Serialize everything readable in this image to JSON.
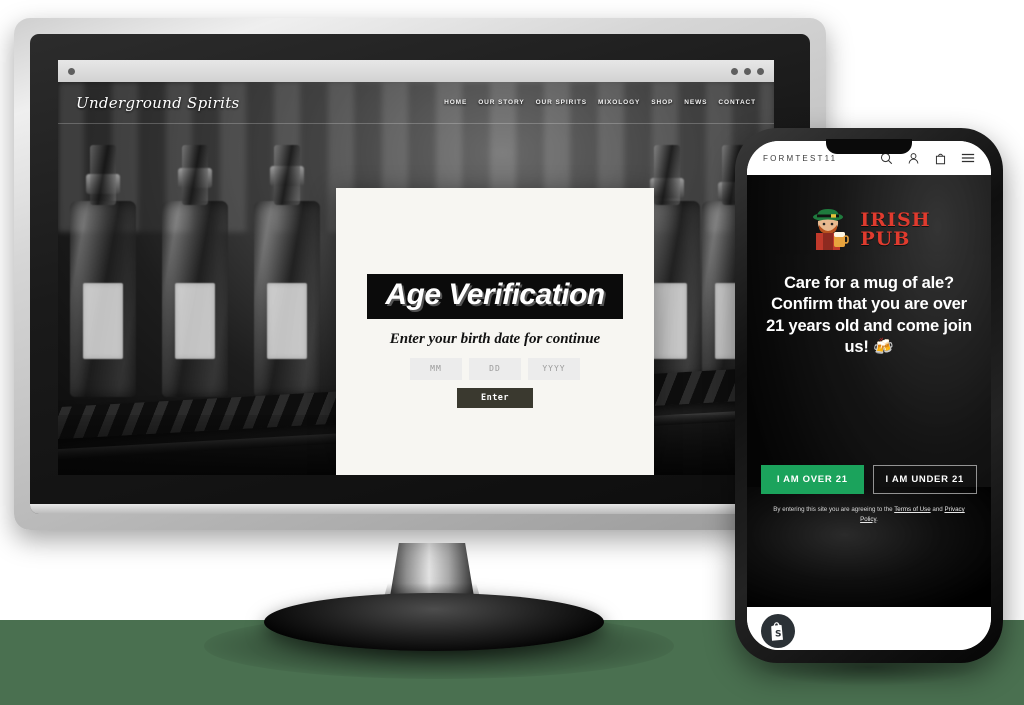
{
  "background": {
    "color": "#4a7050"
  },
  "desktop": {
    "browser": {
      "dots": 3
    },
    "site": {
      "logo": "Underground Spirits",
      "nav": [
        "HOME",
        "OUR STORY",
        "OUR SPIRITS",
        "MIXOLOGY",
        "SHOP",
        "NEWS",
        "CONTACT"
      ],
      "scroll_indicator_icon": "chevron-down-icon"
    },
    "age_modal": {
      "title": "Age Verification",
      "subtitle": "Enter your birth date for continue",
      "fields": [
        {
          "name": "month",
          "placeholder": "MM",
          "value": ""
        },
        {
          "name": "day",
          "placeholder": "DD",
          "value": ""
        },
        {
          "name": "year",
          "placeholder": "YYYY",
          "value": ""
        }
      ],
      "submit_label": "Enter",
      "title_bg": "#0b0b0b",
      "panel_bg": "#f7f6f2",
      "submit_bg": "#3a392f"
    }
  },
  "phone": {
    "header": {
      "brand": "FORMTEST11",
      "icons": [
        "search-icon",
        "account-icon",
        "shopping-bag-icon",
        "hamburger-menu-icon"
      ]
    },
    "age_gate": {
      "logo_text_line1": "IRISH",
      "logo_text_line2": "PUB",
      "logo_color": "#e03b2e",
      "headline": "Care for a mug of ale? Confirm that you are over 21 years old and come join us! 🍻",
      "buttons": [
        {
          "label": "I AM OVER 21",
          "style": "primary",
          "color": "#1ba35c"
        },
        {
          "label": "I AM UNDER 21",
          "style": "outline"
        }
      ],
      "fine_print_prefix": "By entering this site you are agreeing to the ",
      "fine_print_link1": "Terms of Use",
      "fine_print_middle": " and ",
      "fine_print_link2": "Privacy Policy",
      "fine_print_suffix": "."
    },
    "footer": {
      "badge_icon": "shopify-bag-icon"
    }
  }
}
